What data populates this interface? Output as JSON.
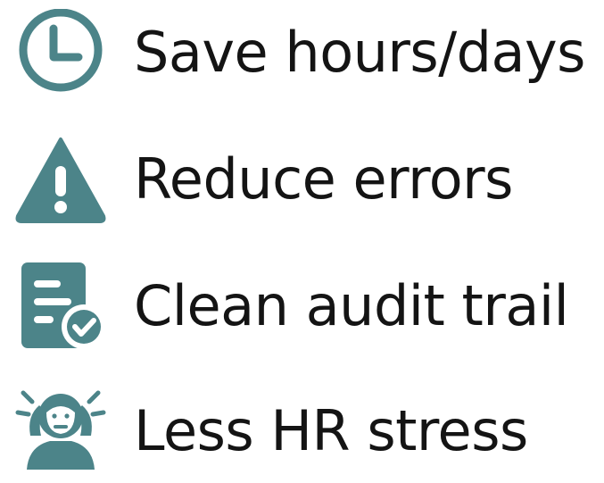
{
  "accent_color": "#4C8489",
  "items": [
    {
      "icon": "clock-icon",
      "label": "Save hours/days"
    },
    {
      "icon": "warning-icon",
      "label": "Reduce errors"
    },
    {
      "icon": "document-check-icon",
      "label": "Clean audit trail"
    },
    {
      "icon": "stressed-person-icon",
      "label": "Less HR stress"
    }
  ]
}
